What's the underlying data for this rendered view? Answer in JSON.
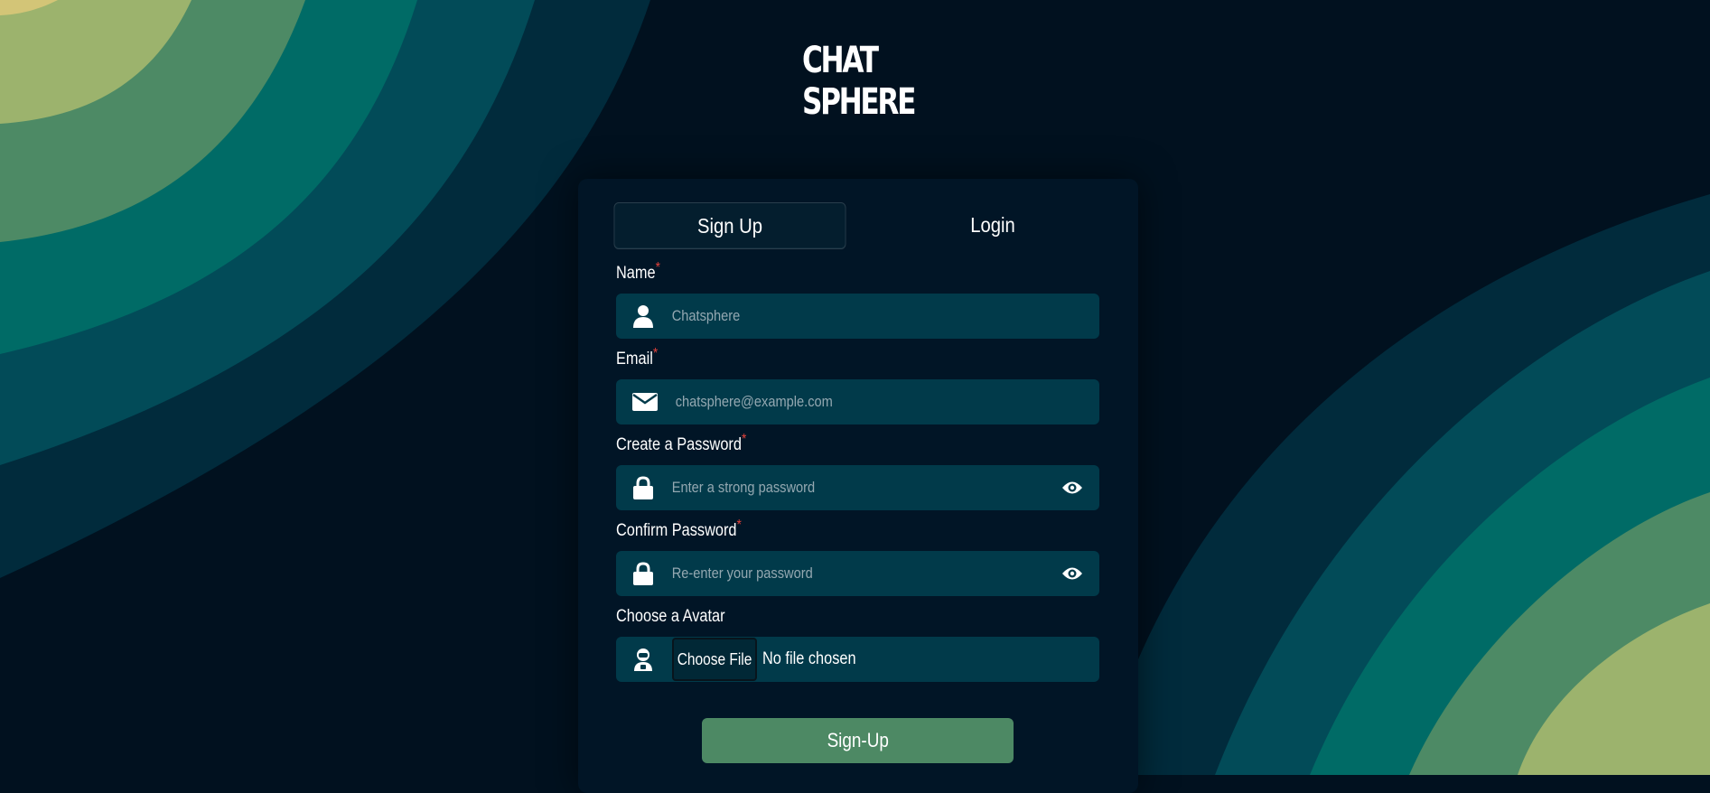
{
  "brand": {
    "logo_line1": "CHAT",
    "logo_line2": "SPHERE"
  },
  "tabs": [
    {
      "label": "Sign Up",
      "active": true
    },
    {
      "label": "Login",
      "active": false
    }
  ],
  "form": {
    "name": {
      "label": "Name",
      "required_mark": "*",
      "placeholder": "Chatsphere",
      "icon": "user-icon"
    },
    "email": {
      "label": "Email",
      "required_mark": "*",
      "placeholder": "chatsphere@example.com",
      "icon": "envelope-icon"
    },
    "password": {
      "label": "Create a Password",
      "required_mark": "*",
      "placeholder": "Enter a strong password",
      "icon": "lock-icon"
    },
    "confirm_password": {
      "label": "Confirm Password",
      "required_mark": "*",
      "placeholder": "Re-enter your password",
      "icon": "lock-icon"
    },
    "avatar": {
      "label": "Choose a Avatar",
      "button_label": "Choose File",
      "status": "No file chosen",
      "icon": "avatar-icon"
    },
    "submit_label": "Sign-Up"
  },
  "colors": {
    "background": "#01111f",
    "card": "#011526",
    "field": "#013a4a",
    "submit": "#4d8964",
    "required": "#e2423b",
    "wave_palette": [
      "#9cb36d",
      "#4d8a65",
      "#006b66",
      "#024b58",
      "#012b3c"
    ]
  }
}
